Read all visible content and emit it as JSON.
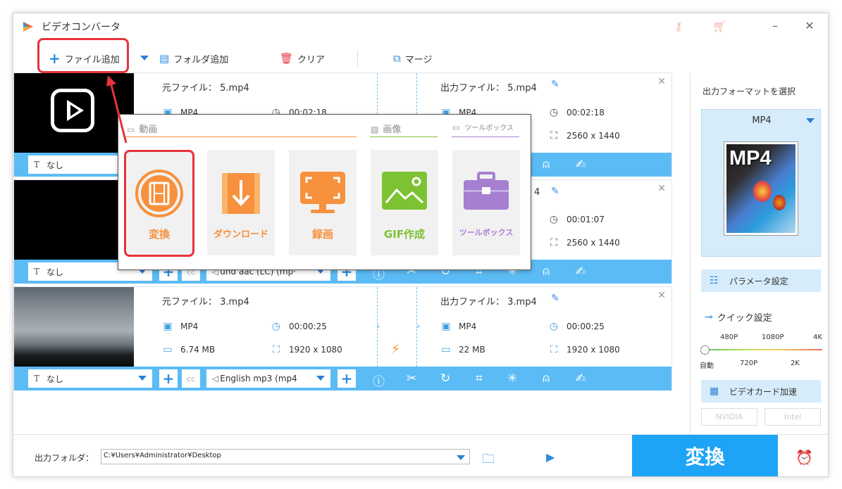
{
  "app": {
    "title": "ビデオコンバータ"
  },
  "toolbar": {
    "add_file": "ファイル追加",
    "add_folder": "フォルダ追加",
    "clear": "クリア",
    "merge": "マージ"
  },
  "items": [
    {
      "src_label": "元ファイル：",
      "src_name": "5.mp4",
      "dst_label": "出力ファイル：",
      "dst_name": "5.mp4",
      "src_format": "MP4",
      "src_duration": "00:02:18",
      "dst_format": "MP4",
      "dst_duration": "00:02:18",
      "dst_resolution": "2560 x 1440",
      "subtitle": "なし"
    },
    {
      "dst_name_tail": "4",
      "dst_duration": "00:01:07",
      "dst_resolution": "2560 x 1440",
      "subtitle": "なし",
      "audio": "und aac (LC) (mp·"
    },
    {
      "src_label": "元ファイル：",
      "src_name": "3.mp4",
      "dst_label": "出力ファイル：",
      "dst_name": "3.mp4",
      "src_format": "MP4",
      "src_duration": "00:00:25",
      "src_size": "6.74 MB",
      "src_resolution": "1920 x 1080",
      "dst_format": "MP4",
      "dst_duration": "00:00:25",
      "dst_size": "22 MB",
      "dst_resolution": "1920 x 1080",
      "subtitle": "なし",
      "audio": "English mp3 (mp4"
    }
  ],
  "popup": {
    "video_header": "動画",
    "image_header": "画像",
    "toolbox_header": "ツールボックス",
    "cards": [
      {
        "label": "変換",
        "icon": "film-convert-icon",
        "color": "#f7913d"
      },
      {
        "label": "ダウンロード",
        "icon": "download-icon",
        "color": "#f7913d"
      },
      {
        "label": "録画",
        "icon": "screen-record-icon",
        "color": "#f7913d"
      },
      {
        "label": "GIF作成",
        "icon": "gif-image-icon",
        "color": "#7cc232"
      },
      {
        "label": "ツールボックス",
        "icon": "toolbox-icon",
        "color": "#a67fd0"
      }
    ]
  },
  "output": {
    "folder_label": "出力フォルダ：",
    "folder_path": "C:¥Users¥Administrator¥Desktop",
    "convert": "変換"
  },
  "panel": {
    "select_format": "出力フォーマットを選択",
    "format": "MP4",
    "format_image_text": "MP4",
    "param": "パラメータ設定",
    "quick": "クイック設定",
    "quality_top": [
      "480P",
      "1080P",
      "4K"
    ],
    "quality_bottom": [
      "自動",
      "720P",
      "2K"
    ],
    "gpu": "ビデオカード加速",
    "nvidia": "NVIDIA",
    "intel": "Intel"
  },
  "colors": {
    "accent": "#1ea4f6",
    "bar": "#5bbbf5",
    "highlight": "#e5333b",
    "orange": "#f7913d"
  }
}
